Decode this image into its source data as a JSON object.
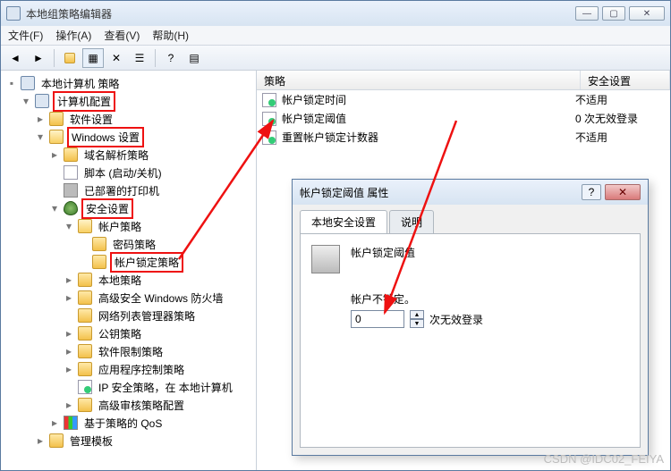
{
  "window": {
    "title": "本地组策略编辑器",
    "menu": {
      "file": "文件(F)",
      "action": "操作(A)",
      "view": "查看(V)",
      "help": "帮助(H)"
    }
  },
  "tree": {
    "root": "本地计算机 策略",
    "computer_config": "计算机配置",
    "software": "软件设置",
    "windows": "Windows 设置",
    "dns_policy": "域名解析策略",
    "scripts": "脚本 (启动/关机)",
    "printers": "已部署的打印机",
    "security": "安全设置",
    "account_policy": "帐户策略",
    "password_policy": "密码策略",
    "lockout_policy": "帐户锁定策略",
    "local_policy": "本地策略",
    "firewall": "高级安全 Windows 防火墙",
    "netlist": "网络列表管理器策略",
    "pubkey": "公钥策略",
    "software_restrict": "软件限制策略",
    "app_control": "应用程序控制策略",
    "ipsec": "IP 安全策略，在 本地计算机",
    "audit": "高级审核策略配置",
    "qos": "基于策略的 QoS",
    "templates": "管理模板"
  },
  "list": {
    "col_policy": "策略",
    "col_setting": "安全设置",
    "rows": [
      {
        "name": "帐户锁定时间",
        "value": "不适用"
      },
      {
        "name": "帐户锁定阈值",
        "value": "0 次无效登录"
      },
      {
        "name": "重置帐户锁定计数器",
        "value": "不适用"
      }
    ]
  },
  "dialog": {
    "title": "帐户锁定阈值 属性",
    "tab1": "本地安全设置",
    "tab2": "说明",
    "prop_name": "帐户锁定阈值",
    "nolock": "帐户不锁定。",
    "unit": "次无效登录",
    "value": "0"
  },
  "watermark": "CSDN @IDC02_FEIYA"
}
